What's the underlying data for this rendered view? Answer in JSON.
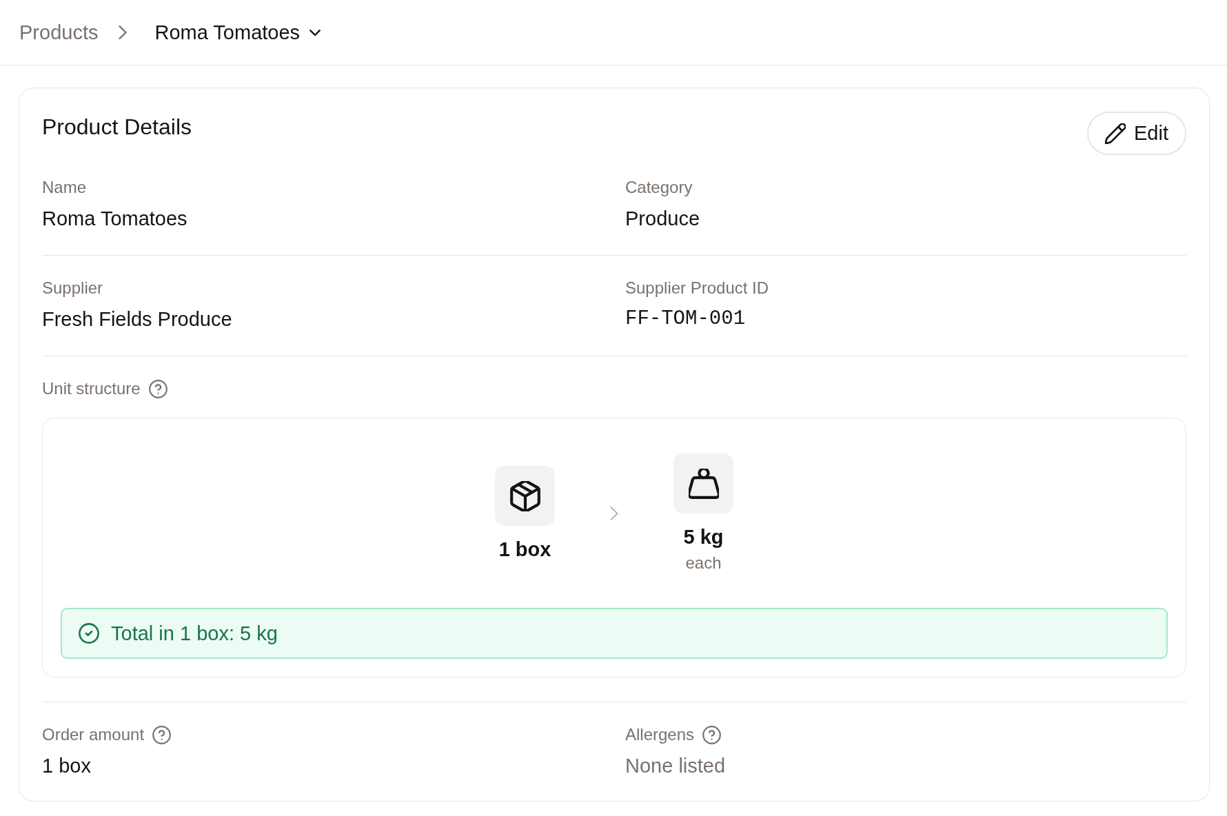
{
  "breadcrumb": {
    "parent": "Products",
    "current": "Roma Tomatoes"
  },
  "card": {
    "title": "Product Details",
    "edit_button": "Edit",
    "sections": [
      {
        "kind": "fields",
        "fields": [
          {
            "label": "Name",
            "value": "Roma Tomatoes",
            "kind": "text",
            "help_icon": false
          },
          {
            "label": "Category",
            "value": "Produce",
            "kind": "text",
            "help_icon": false
          }
        ]
      },
      {
        "kind": "fields",
        "fields": [
          {
            "label": "Supplier",
            "value": "Fresh Fields Produce",
            "kind": "text",
            "help_icon": false
          },
          {
            "label": "Supplier Product ID",
            "value": "FF-TOM-001",
            "kind": "code",
            "help_icon": false
          }
        ]
      },
      {
        "kind": "units",
        "label": "Unit structure",
        "help_icon": true,
        "units": [
          {
            "kind": "box",
            "quantity": "1 box"
          },
          {
            "kind": "weight",
            "quantity": "5 kg",
            "note": "each"
          }
        ],
        "summary": "Total in 1 box: 5 kg"
      },
      {
        "kind": "fields",
        "fields": [
          {
            "label": "Order amount",
            "value": "1 box",
            "kind": "text",
            "help_icon": true
          },
          {
            "label": "Allergens",
            "value": "None listed",
            "kind": "empty",
            "help_icon": true
          }
        ]
      }
    ]
  }
}
